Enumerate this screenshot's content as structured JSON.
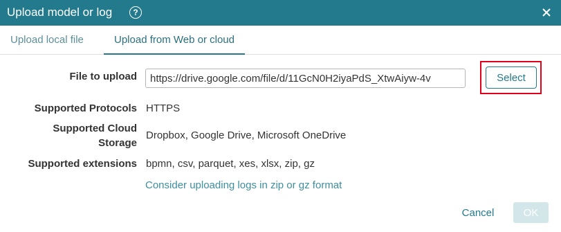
{
  "dialog": {
    "title": "Upload model or log",
    "help_icon": "question-circle-icon",
    "close_icon": "close-icon",
    "close_glyph": "×",
    "help_glyph": "?"
  },
  "tabs": [
    {
      "label": "Upload local file",
      "active": false
    },
    {
      "label": "Upload from Web or cloud",
      "active": true
    }
  ],
  "form": {
    "file_label": "File to upload",
    "file_value": "https://drive.google.com/file/d/11GcN0H2iyaPdS_XtwAiyw-4v",
    "select_label": "Select",
    "protocols_label": "Supported Protocols",
    "protocols_value": "HTTPS",
    "cloud_label_line1": "Supported Cloud",
    "cloud_label_line2": "Storage",
    "cloud_value": "Dropbox, Google Drive, Microsoft OneDrive",
    "extensions_label": "Supported extensions",
    "extensions_value": "bpmn, csv, parquet, xes, xlsx, zip, gz",
    "hint_link": "Consider uploading logs in zip or gz format"
  },
  "footer": {
    "cancel_label": "Cancel",
    "ok_label": "OK",
    "ok_disabled": true
  },
  "colors": {
    "accent": "#227a8c",
    "highlight": "#e3001b",
    "disabled_button": "#d3e6ea"
  }
}
